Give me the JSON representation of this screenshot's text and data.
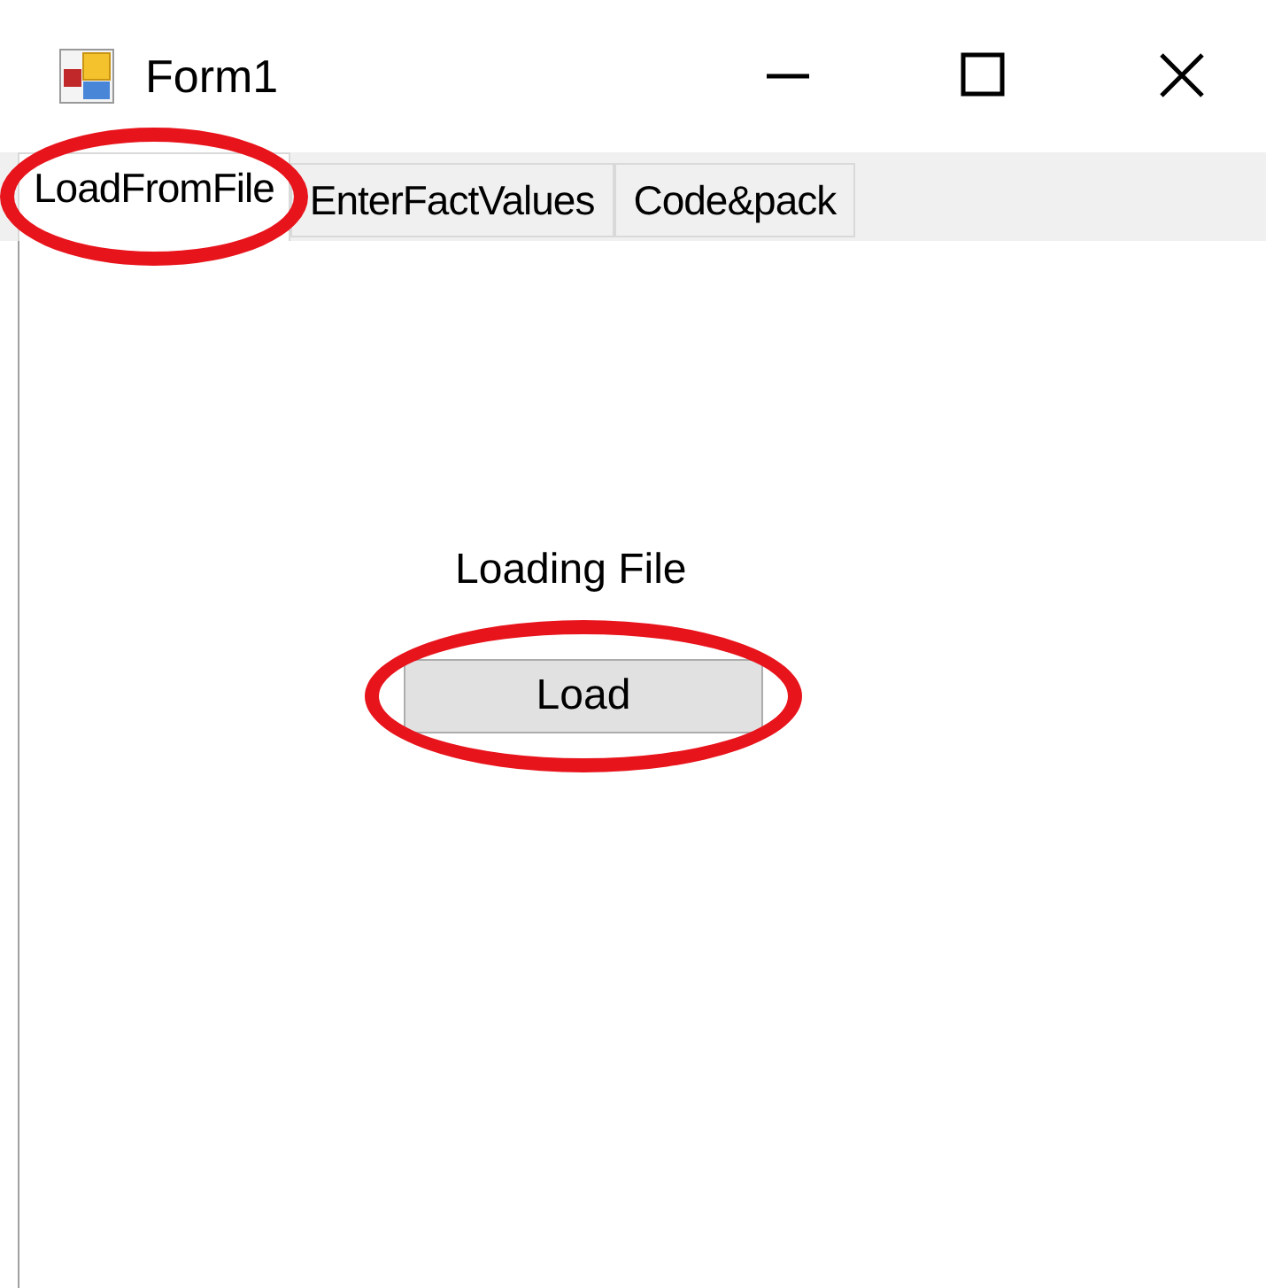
{
  "window": {
    "title": "Form1"
  },
  "tabs": [
    {
      "label": "LoadFromFile",
      "selected": true,
      "circled": true
    },
    {
      "label": "EnterFactValues",
      "selected": false,
      "circled": false
    },
    {
      "label": "Code&pack",
      "selected": false,
      "circled": false
    }
  ],
  "panel": {
    "label": "Loading File",
    "button": {
      "label": "Load",
      "circled": true
    }
  }
}
